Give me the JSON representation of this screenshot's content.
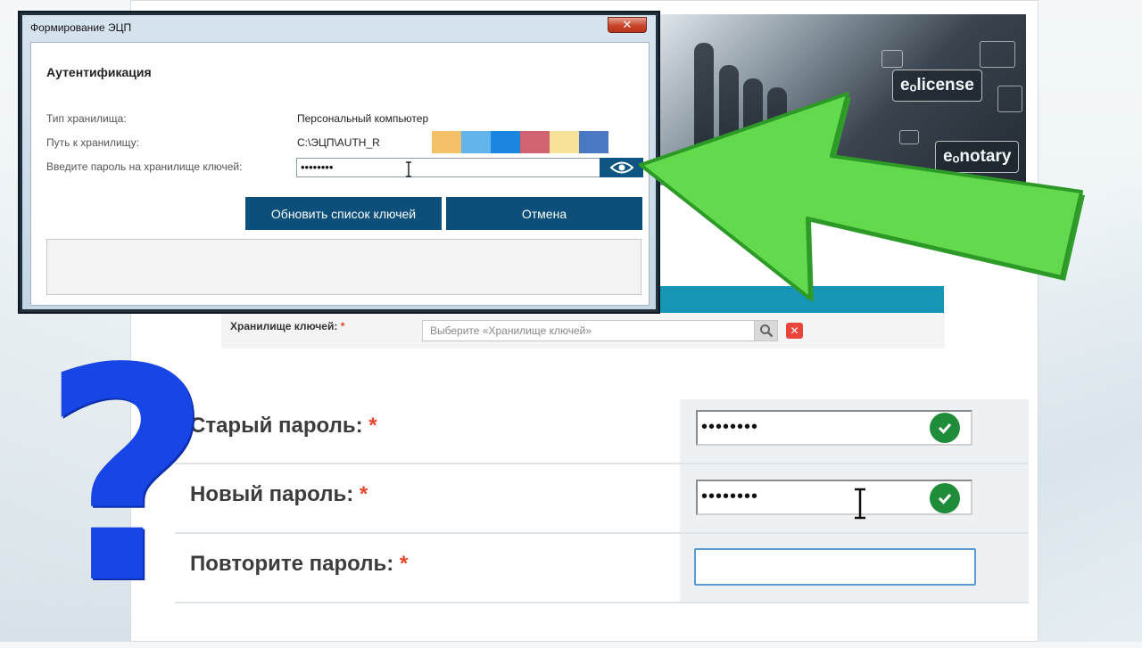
{
  "dialog": {
    "title": "Формирование ЭЦП",
    "close_symbol": "✕",
    "heading": "Аутентификация",
    "fields": [
      {
        "label": "Тип хранилища:",
        "value": "Персональный компьютер"
      },
      {
        "label": "Путь к хранилищу:",
        "value": "C:\\ЭЦП\\AUTH_R"
      },
      {
        "label": "Введите пароль на хранилище ключей:",
        "value": "••••••••"
      }
    ],
    "swatch_colors": [
      "#f5c06a",
      "#63b4ea",
      "#1a86e0",
      "#d06370",
      "#f7e29a",
      "#4a78c2"
    ],
    "refresh_button": "Обновить список ключей",
    "cancel_button": "Отмена"
  },
  "banner": {
    "badges": [
      "eₒlicense",
      "eₒnotary"
    ]
  },
  "keystore": {
    "label": "Хранилище ключей:",
    "required_mark": "*",
    "placeholder": "Выберите «Хранилище ключей»"
  },
  "password_form": {
    "rows": [
      {
        "label": "Старый пароль:",
        "required_mark": "*",
        "value": "••••••••",
        "valid": true
      },
      {
        "label": "Новый пароль:",
        "required_mark": "*",
        "value": "••••••••",
        "valid": true
      },
      {
        "label": "Повторите пароль:",
        "required_mark": "*",
        "value": "",
        "valid": false
      }
    ]
  },
  "overlay": {
    "question_mark": "?"
  },
  "colors": {
    "primary_button": "#0b4f7a",
    "teal_bar": "#1695b5",
    "arrow_green": "#5ed64a",
    "question_blue": "#1846e6",
    "check_green": "#1f8c3a"
  }
}
